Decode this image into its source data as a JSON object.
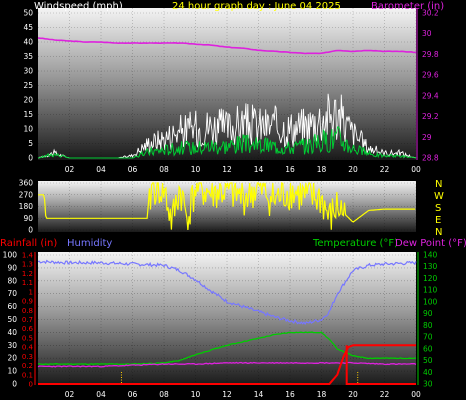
{
  "header": {
    "windspeed_label": "Windspeed (mph)",
    "title": "24 hour graph day : June 04 2025",
    "barometer_label": "Barometer (in)"
  },
  "compass_letters": [
    "N",
    "W",
    "S",
    "E",
    "N"
  ],
  "bottom_labels": {
    "rainfall": "Rainfall (in)",
    "humidity": "Humidity",
    "temperature": "Temperature (°F)",
    "dewpoint": "Dew Point (°F)"
  },
  "colors": {
    "wind_speed": "#ffffff",
    "wind_gust": "#00cc33",
    "barometer": "#dd22dd",
    "direction": "#ffff00",
    "humidity": "#7777ff",
    "temperature": "#00cc00",
    "dewpoint": "#dd22dd",
    "rainfall": "#ff0000",
    "rain_rate": "#ffcc00",
    "compass": "#ffff00",
    "header_title": "#ffff00",
    "barometer_label": "#dd22dd"
  },
  "chart_data": [
    {
      "type": "line",
      "name": "wind-barometer",
      "x_ticks": [
        "02",
        "04",
        "06",
        "08",
        "10",
        "12",
        "14",
        "16",
        "18",
        "20",
        "22",
        "00"
      ],
      "y_left_ticks": [
        "50",
        "45",
        "40",
        "35",
        "30",
        "25",
        "20",
        "15",
        "10",
        "5",
        "0"
      ],
      "y_right_ticks": [
        "30.2",
        "30",
        "29.8",
        "29.6",
        "29.4",
        "29.2",
        "29",
        "28.8"
      ],
      "ylim_left": [
        0,
        50
      ],
      "ylim_right": [
        28.8,
        30.2
      ],
      "series": [
        {
          "key": "barometer",
          "axis": "right",
          "x": [
            0,
            1,
            2,
            3,
            4,
            5,
            6,
            7,
            8,
            9,
            10,
            11,
            12,
            13,
            14,
            15,
            16,
            17,
            18,
            19,
            20,
            21,
            22,
            23,
            24
          ],
          "values": [
            29.96,
            29.94,
            29.93,
            29.92,
            29.92,
            29.91,
            29.91,
            29.91,
            29.91,
            29.91,
            29.9,
            29.89,
            29.87,
            29.86,
            29.84,
            29.83,
            29.82,
            29.81,
            29.81,
            29.84,
            29.83,
            29.84,
            29.83,
            29.83,
            29.82
          ]
        },
        {
          "key": "wind_speed",
          "axis": "left",
          "x": [
            0,
            1,
            2,
            3,
            4,
            5,
            6,
            7,
            8,
            9,
            10,
            11,
            12,
            13,
            14,
            15,
            16,
            17,
            18,
            19,
            20,
            21,
            22,
            23,
            24
          ],
          "values": [
            0,
            2,
            0,
            0,
            0,
            0,
            0,
            3,
            4,
            5,
            5,
            6,
            6,
            7,
            6,
            6,
            5,
            6,
            8,
            10,
            5,
            2,
            1,
            1,
            0
          ]
        },
        {
          "key": "wind_gust",
          "axis": "left",
          "x": [
            0,
            1,
            2,
            3,
            4,
            5,
            6,
            7,
            8,
            9,
            10,
            11,
            12,
            13,
            14,
            15,
            16,
            17,
            18,
            19,
            20,
            21,
            22,
            23,
            24
          ],
          "values": [
            0,
            2,
            0,
            0,
            0,
            0,
            1,
            6,
            8,
            11,
            12,
            13,
            12,
            14,
            13,
            13,
            12,
            13,
            16,
            18,
            10,
            4,
            2,
            2,
            0
          ]
        }
      ]
    },
    {
      "type": "line",
      "name": "wind-direction",
      "x_ticks": [
        "02",
        "04",
        "06",
        "08",
        "10",
        "12",
        "14",
        "16",
        "18",
        "20",
        "22",
        "00"
      ],
      "y_ticks": [
        "360",
        "270",
        "180",
        "90",
        "0"
      ],
      "ylim": [
        0,
        360
      ],
      "series": [
        {
          "key": "direction",
          "x": [
            0,
            0.4,
            0.5,
            1,
            6,
            7,
            7.2,
            8,
            8.5,
            9,
            9.5,
            10,
            11,
            12,
            13,
            14,
            15,
            16,
            17,
            18,
            18.5,
            19,
            19.5,
            20,
            21,
            22,
            24
          ],
          "values": [
            270,
            270,
            90,
            90,
            90,
            90,
            330,
            310,
            60,
            320,
            80,
            330,
            280,
            300,
            250,
            320,
            230,
            300,
            250,
            240,
            80,
            180,
            120,
            60,
            150,
            160,
            160
          ]
        }
      ]
    },
    {
      "type": "line",
      "name": "temperature-humidity-rain",
      "x_ticks": [
        "02",
        "04",
        "06",
        "08",
        "10",
        "12",
        "14",
        "16",
        "18",
        "20",
        "22",
        "00"
      ],
      "y_humidity_ticks": [
        "100",
        "90",
        "80",
        "70",
        "60",
        "50",
        "40",
        "30",
        "20",
        "10",
        "0"
      ],
      "y_rain_ticks": [
        "1.4",
        "1.3",
        "1.2",
        "1.1",
        "1",
        "0.9",
        "0.8",
        "0.7",
        "0.6",
        "0.5",
        "0.4",
        "0.3",
        "0.2",
        "0.1",
        "0"
      ],
      "y_temp_ticks": [
        "140",
        "130",
        "120",
        "110",
        "100",
        "90",
        "80",
        "70",
        "60",
        "50",
        "40",
        "30"
      ],
      "ylim_humidity": [
        0,
        100
      ],
      "ylim_rain": [
        0,
        1.4
      ],
      "ylim_temp": [
        30,
        140
      ],
      "series": [
        {
          "key": "humidity",
          "axis": "humidity",
          "x": [
            0,
            2,
            4,
            6,
            8,
            9,
            10,
            11,
            12,
            13,
            14,
            15,
            16,
            17,
            18,
            18.5,
            19,
            20,
            21,
            22,
            24
          ],
          "values": [
            95,
            94,
            94,
            93,
            92,
            88,
            81,
            72,
            64,
            60,
            56,
            52,
            49,
            47,
            50,
            56,
            70,
            88,
            92,
            93,
            94
          ]
        },
        {
          "key": "temperature",
          "axis": "temp",
          "x": [
            0,
            2,
            4,
            6,
            8,
            9,
            10,
            11,
            12,
            13,
            14,
            15,
            16,
            17,
            18,
            18.5,
            19,
            20,
            21,
            22,
            24
          ],
          "values": [
            47,
            47,
            47,
            47,
            48,
            50,
            55,
            59,
            63,
            66,
            69,
            72,
            74,
            74,
            74,
            68,
            60,
            54,
            52,
            52,
            52
          ]
        },
        {
          "key": "dewpoint",
          "axis": "temp",
          "x": [
            0,
            2,
            4,
            6,
            8,
            10,
            12,
            14,
            16,
            18,
            20,
            22,
            24
          ],
          "values": [
            45,
            45,
            45,
            46,
            47,
            47,
            48,
            48,
            48,
            48,
            48,
            47,
            47
          ]
        },
        {
          "key": "rainfall",
          "axis": "rain",
          "x": [
            0,
            18.5,
            19,
            19.4,
            19.7,
            20,
            24
          ],
          "values": [
            0,
            0,
            0.1,
            0.3,
            0.4,
            0.42,
            0.42
          ]
        }
      ]
    }
  ]
}
